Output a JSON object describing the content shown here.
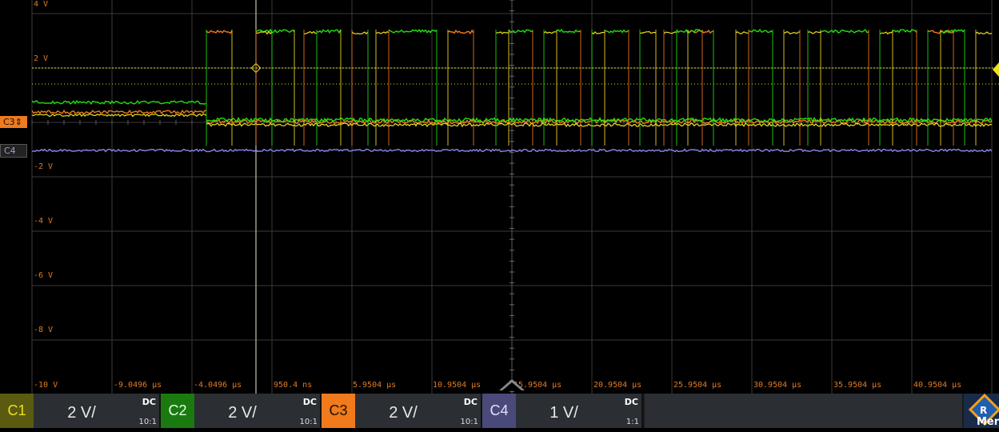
{
  "screen": {
    "y_labels": [
      "4 V",
      "2 V",
      "-2 V",
      "-4 V",
      "-6 V",
      "-8 V",
      "-10 V"
    ],
    "x_labels": [
      "-9.0496 µs",
      "-4.0496 µs",
      "950.4 ns",
      "5.9504 µs",
      "10.9504 µs",
      "15.9504 µs",
      "20.9504 µs",
      "25.9504 µs",
      "30.9504 µs",
      "35.9504 µs",
      "40.9504 µs"
    ],
    "markers": {
      "c3": "C3",
      "c4": "C4"
    }
  },
  "colors": {
    "c1": "#f0e020",
    "c2": "#22e010",
    "c3": "#f07a1c",
    "c4": "#8a86e8",
    "grid": "#3a3a3a",
    "trigger": "#f0e020"
  },
  "channels": [
    {
      "tag": "C1",
      "scale": "2 V/",
      "coupling": "DC",
      "probe": "10:1",
      "tag_bg": "#5a5a10",
      "tag_fg": "#f0e020"
    },
    {
      "tag": "C2",
      "scale": "2 V/",
      "coupling": "DC",
      "probe": "10:1",
      "tag_bg": "#1a7a10",
      "tag_fg": "#e0ffe0"
    },
    {
      "tag": "C3",
      "scale": "2 V/",
      "coupling": "DC",
      "probe": "10:1",
      "tag_bg": "#f07a1c",
      "tag_fg": "#201000"
    },
    {
      "tag": "C4",
      "scale": "1 V/",
      "coupling": "DC",
      "probe": "1:1",
      "tag_bg": "#4a4a7a",
      "tag_fg": "#e0e0ff"
    }
  ],
  "logo": {
    "icon": "rohde-schwarz-logo",
    "text": "Mer"
  }
}
